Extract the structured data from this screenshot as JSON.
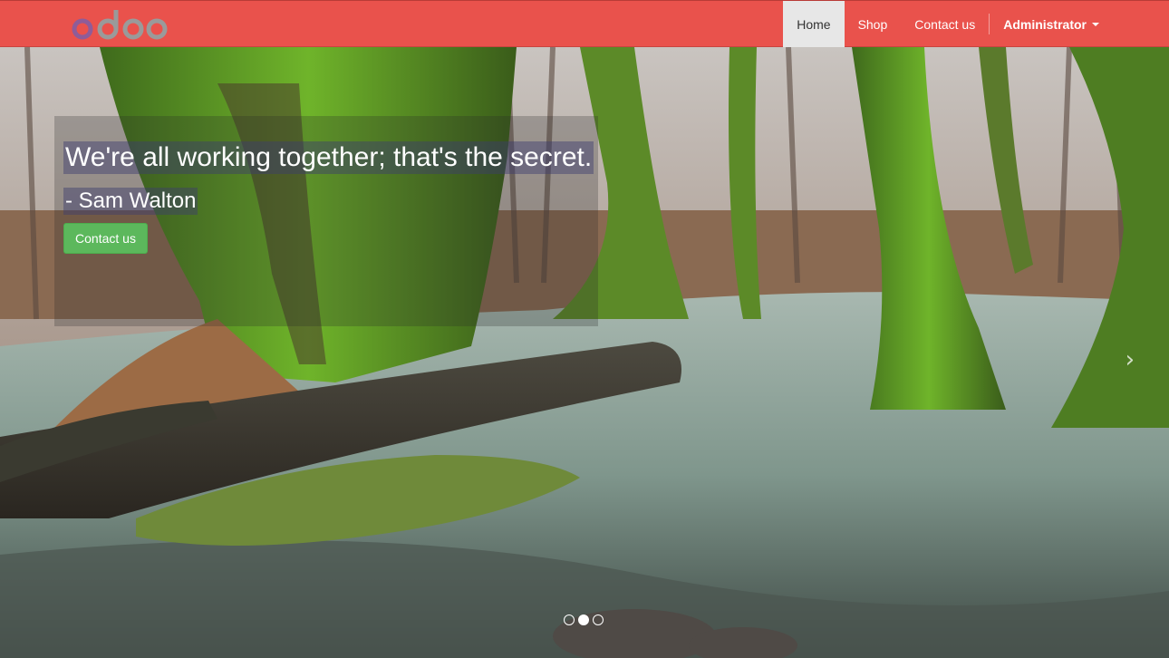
{
  "brand": {
    "logo_text": "odoo",
    "logo_color": "#8f5c98"
  },
  "navbar": {
    "background": "#e9524c",
    "items": [
      {
        "label": "Home",
        "active": true
      },
      {
        "label": "Shop",
        "active": false
      },
      {
        "label": "Contact us",
        "active": false
      }
    ],
    "user": {
      "label": "Administrator",
      "icon": "caret-down-icon"
    }
  },
  "hero": {
    "quote": "We're all working together; that's the secret.",
    "author": "- Sam Walton",
    "cta_label": "Contact us",
    "cta_color": "#5cb85c",
    "next_icon": "chevron-right-icon",
    "next_glyph": "›",
    "slides": 3,
    "active_slide": 1
  }
}
